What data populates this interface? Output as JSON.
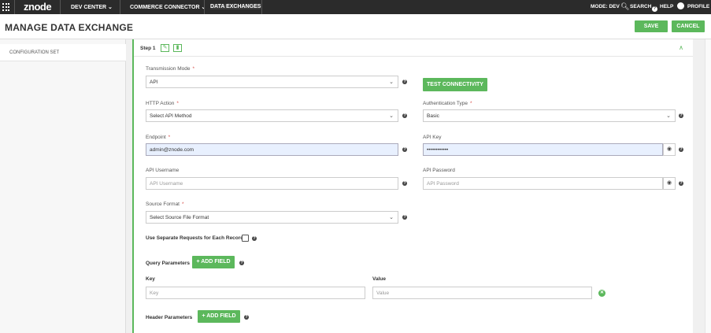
{
  "topbar": {
    "logo": "znode",
    "nav": [
      "DEV CENTER ⌄",
      "COMMERCE CONNECTOR ⌄",
      "DATA EXCHANGES"
    ],
    "mode": "MODE: DEV",
    "search": "SEARCH",
    "help": "HELP",
    "profile": "PROFILE",
    "icons": [
      "grid-icon",
      "search-icon",
      "help-icon",
      "profile-icon"
    ]
  },
  "header": {
    "title": "MANAGE DATA EXCHANGE",
    "save": "SAVE",
    "cancel": "CANCEL"
  },
  "sidebar": {
    "items": [
      "CONFIGURATION SET"
    ]
  },
  "step": {
    "label": "Step 1"
  },
  "form": {
    "transmission_mode": {
      "label": "Transmission Mode",
      "required": "*",
      "value": "API"
    },
    "test_connectivity": "TEST CONNECTIVITY",
    "http_action": {
      "label": "HTTP Action",
      "required": "*",
      "value": "Select API Method"
    },
    "auth_type": {
      "label": "Authentication Type",
      "required": "*",
      "value": "Basic"
    },
    "endpoint": {
      "label": "Endpoint",
      "required": "*",
      "value": "admin@znode.com"
    },
    "api_key": {
      "label": "API Key",
      "value": "••••••••••••"
    },
    "api_username": {
      "label": "API Username",
      "placeholder": "API Username"
    },
    "api_password": {
      "label": "API Password",
      "placeholder": "API Password"
    },
    "source_format": {
      "label": "Source Format",
      "required": "*",
      "value": "Select Source File Format"
    },
    "separate_requests": "Use Separate Requests for Each Record",
    "query_params": {
      "label": "Query Parameters",
      "add": "+ ADD FIELD",
      "key_label": "Key",
      "value_label": "Value",
      "key_placeholder": "Key",
      "value_placeholder": "Value"
    },
    "header_params": {
      "label": "Header Parameters",
      "add": "+ ADD FIELD"
    }
  },
  "colors": {
    "accent": "#5cb85c",
    "topbar": "#2b2b2b",
    "required": "#d9534f"
  }
}
